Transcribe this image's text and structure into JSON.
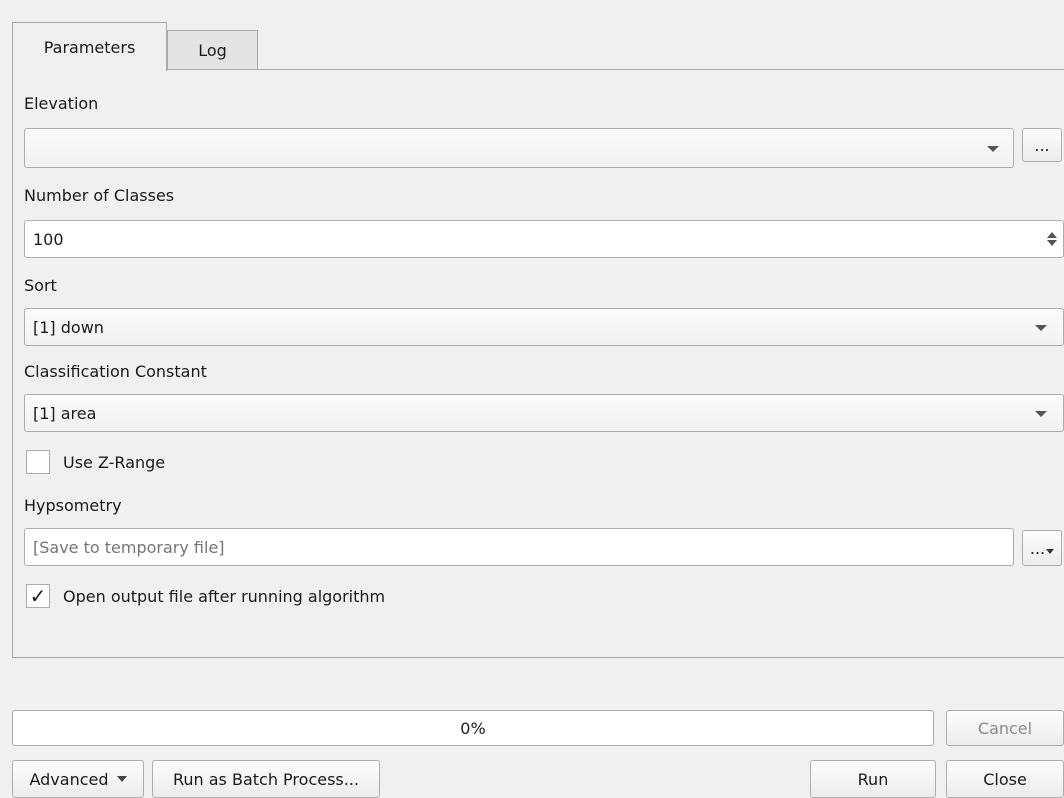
{
  "tabs": [
    {
      "label": "Parameters"
    },
    {
      "label": "Log"
    }
  ],
  "params": {
    "elevation": {
      "label": "Elevation",
      "value": "",
      "browse_label": "..."
    },
    "classes": {
      "label": "Number of Classes",
      "value": "100"
    },
    "sort": {
      "label": "Sort",
      "value": "[1] down"
    },
    "constant": {
      "label": "Classification Constant",
      "value": "[1] area"
    },
    "zrange": {
      "label": "Use Z-Range",
      "checked": false
    },
    "hypsometry": {
      "label": "Hypsometry",
      "placeholder": "[Save to temporary file]",
      "browse_label": "..."
    },
    "open_output": {
      "label": "Open output file after running algorithm",
      "checked": true,
      "mark": "✓"
    }
  },
  "progress": {
    "value": 0,
    "text": "0%"
  },
  "buttons": {
    "cancel": "Cancel",
    "advanced": "Advanced",
    "batch": "Run as Batch Process...",
    "run": "Run",
    "close": "Close"
  },
  "colors": {
    "progress_fill": "#3daee9",
    "disabled_text": "#8a8a8a",
    "placeholder_text": "#8a8a8a"
  }
}
